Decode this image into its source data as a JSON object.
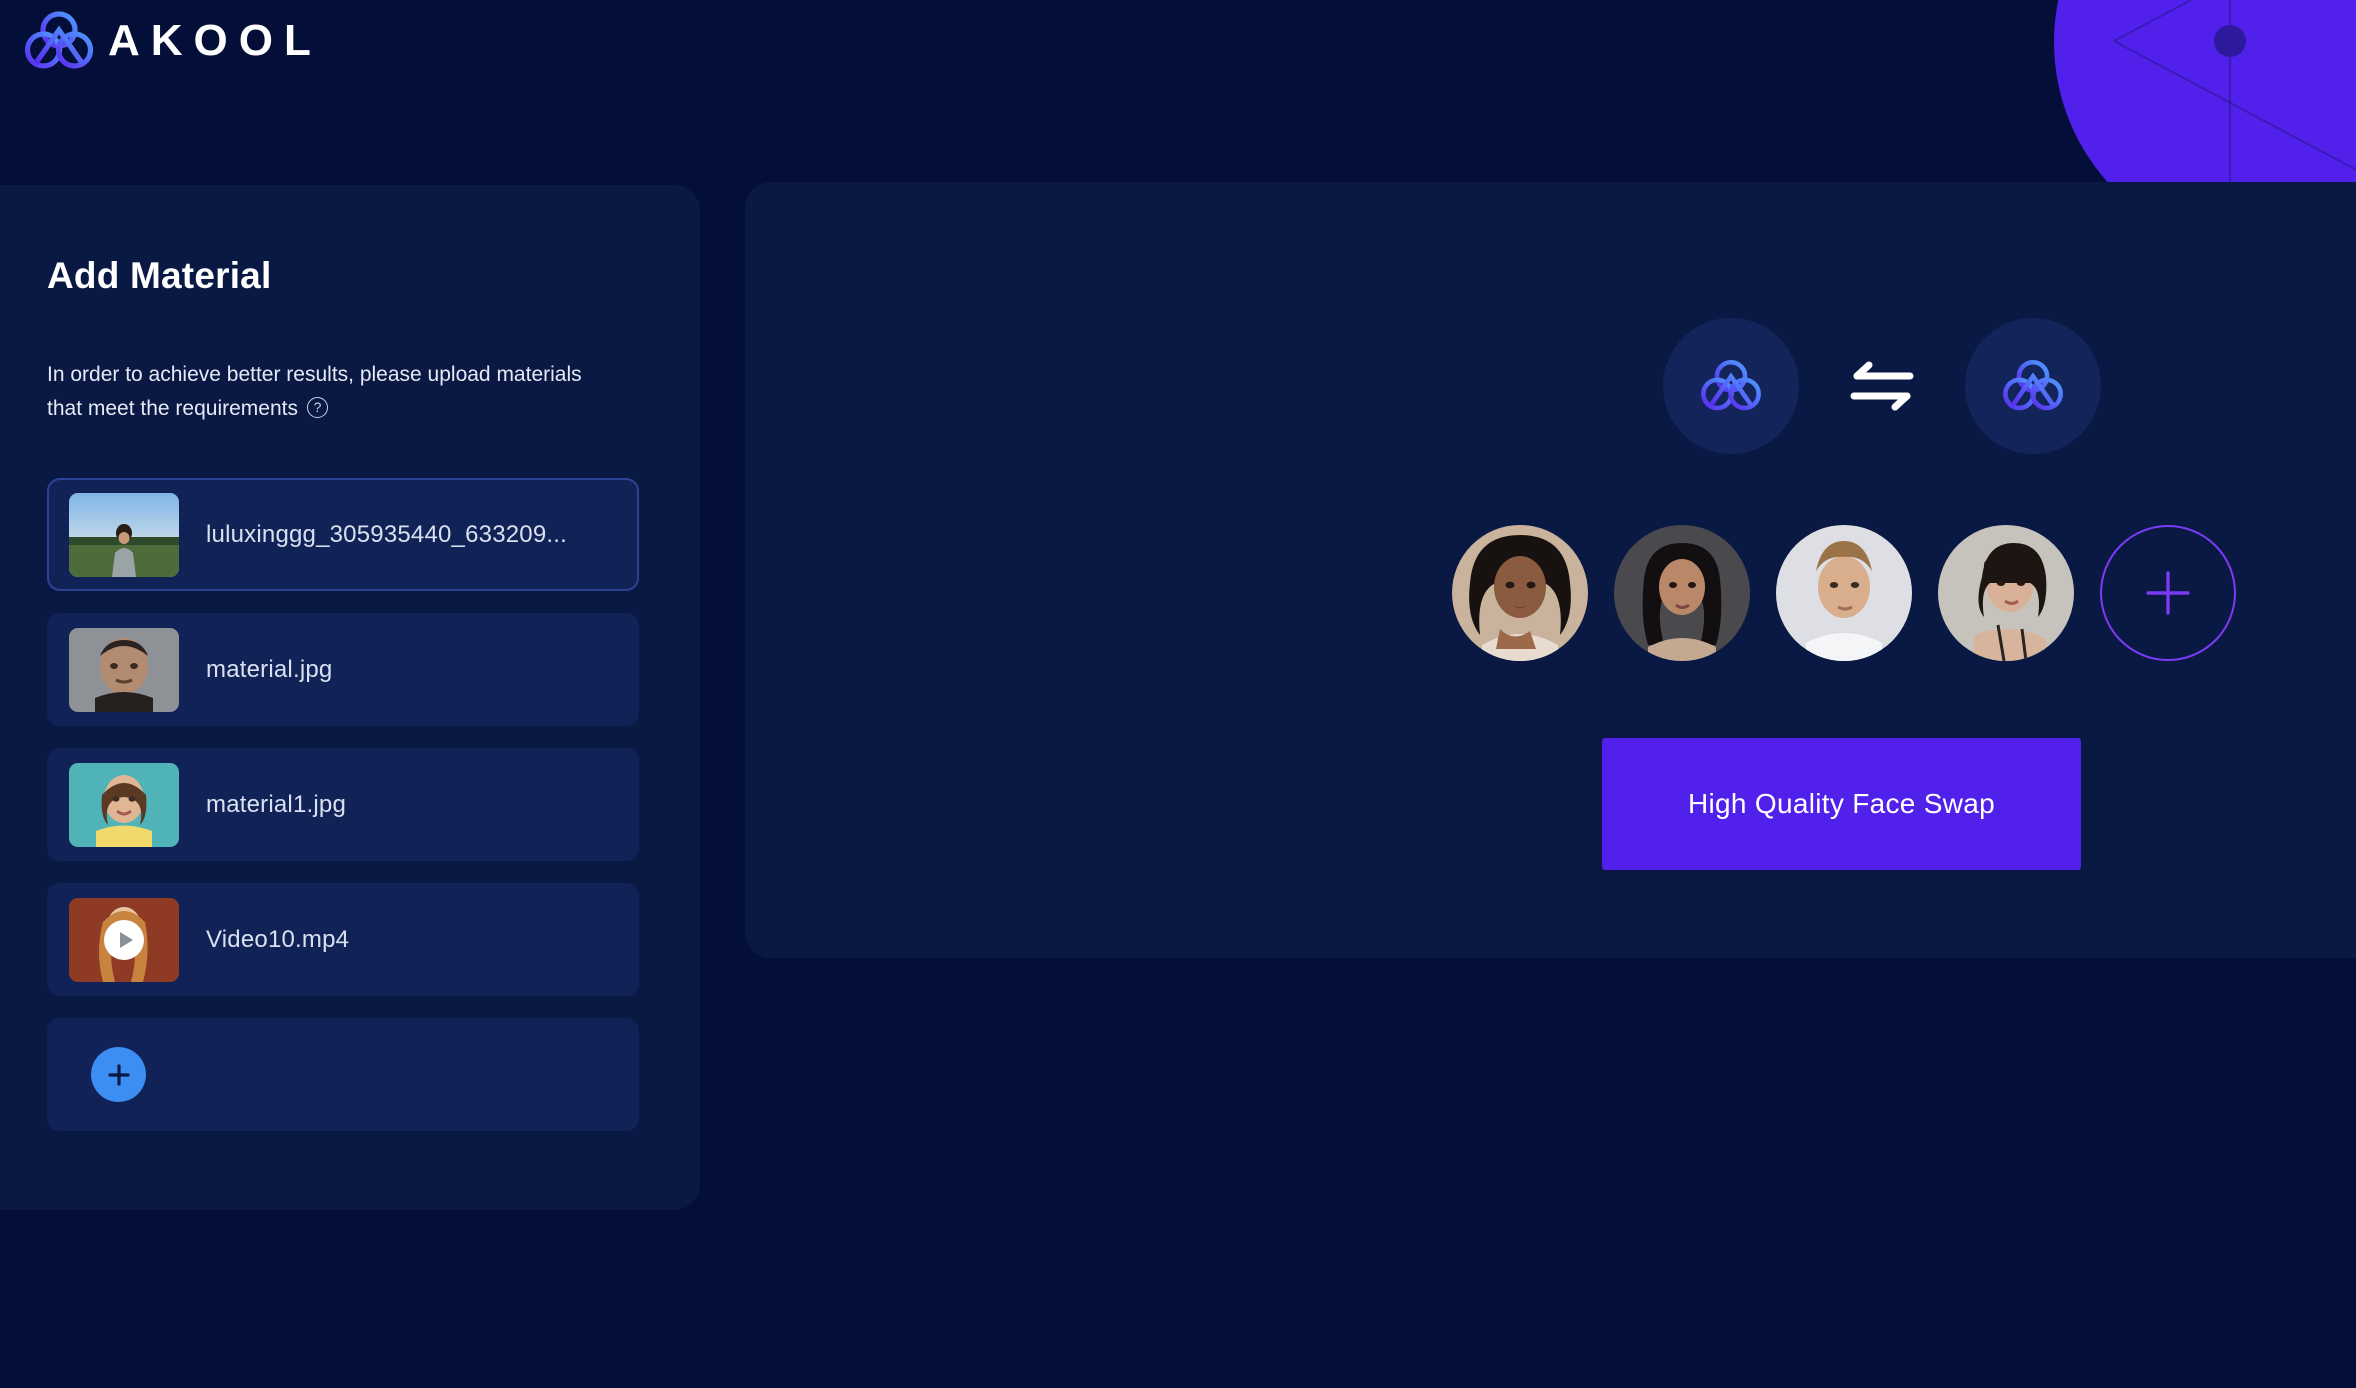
{
  "brand": {
    "name": "AKOOL",
    "logo_icon": "akool-trefoil-logo"
  },
  "sidebar": {
    "title": "Add Material",
    "description": "In order to achieve better results, please upload materials that meet the requirements",
    "help_icon": "question-circle-icon",
    "add_button_icon": "plus-icon",
    "items": [
      {
        "name": "luluxinggg_305935440_633209...",
        "type": "image",
        "selected": true,
        "thumb_icon": "photo-thumbnail-woman-field"
      },
      {
        "name": "material.jpg",
        "type": "image",
        "selected": false,
        "thumb_icon": "photo-thumbnail-man-portrait"
      },
      {
        "name": "material1.jpg",
        "type": "image",
        "selected": false,
        "thumb_icon": "photo-thumbnail-woman-yellow"
      },
      {
        "name": "Video10.mp4",
        "type": "video",
        "selected": false,
        "thumb_icon": "video-thumbnail-woman-red",
        "play_icon": "play-icon"
      }
    ]
  },
  "main": {
    "swap": {
      "source_icon": "akool-logo-avatar",
      "swap_icon": "swap-arrows-icon",
      "target_icon": "akool-logo-avatar"
    },
    "faces": [
      {
        "label": "face-1",
        "icon": "face-thumbnail-curly-hair-woman"
      },
      {
        "label": "face-2",
        "icon": "face-thumbnail-dark-hair-woman"
      },
      {
        "label": "face-3",
        "icon": "face-thumbnail-young-man"
      },
      {
        "label": "face-4",
        "icon": "face-thumbnail-bob-hair-woman"
      }
    ],
    "add_face_icon": "plus-icon",
    "cta_label": "High Quality Face Swap"
  },
  "colors": {
    "page_background": "#030F38",
    "panel_background": "#0A1943",
    "list_item_background": "#112257",
    "accent_purple": "#5220EB",
    "accent_blue": "#3C8EF2",
    "add_outline_purple": "#7B3BF5",
    "text_primary": "#FFFFFF",
    "text_secondary": "#D9E0F0"
  }
}
